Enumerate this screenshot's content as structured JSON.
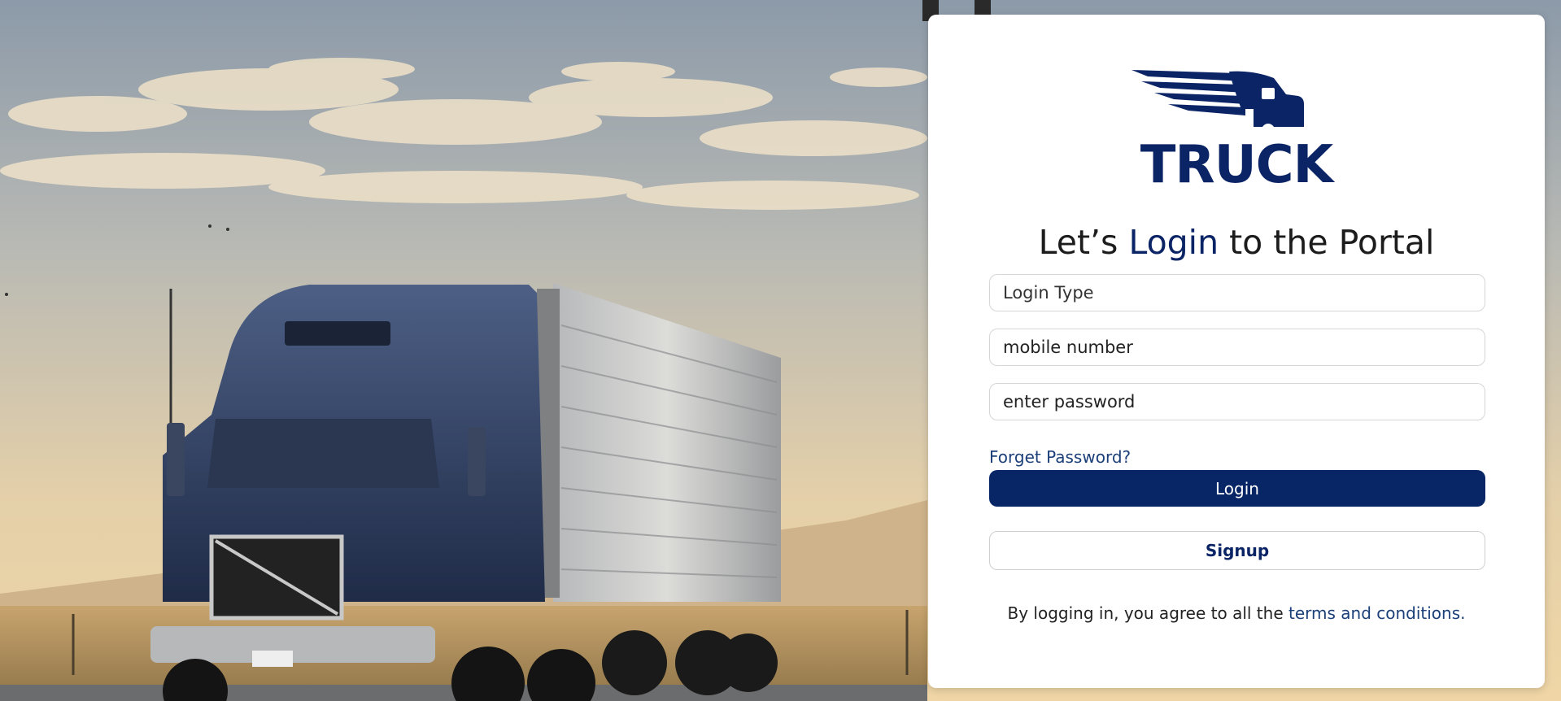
{
  "brand": {
    "logo_icon": "truck-speed-logo-icon",
    "name": "TRUCK"
  },
  "heading": {
    "prefix": "Let’s ",
    "accent": "Login",
    "suffix": " to the Portal"
  },
  "form": {
    "login_type_placeholder": "Login Type",
    "mobile_placeholder": "mobile number",
    "password_placeholder": "enter password",
    "forget_password": "Forget Password?",
    "login_button": "Login",
    "signup_button": "Signup"
  },
  "terms": {
    "prefix": "By logging in, you agree to all the ",
    "link": "terms and conditions."
  },
  "colors": {
    "brand_navy": "#0b2466",
    "button_navy": "#082666",
    "link_blue": "#1b3f79"
  }
}
